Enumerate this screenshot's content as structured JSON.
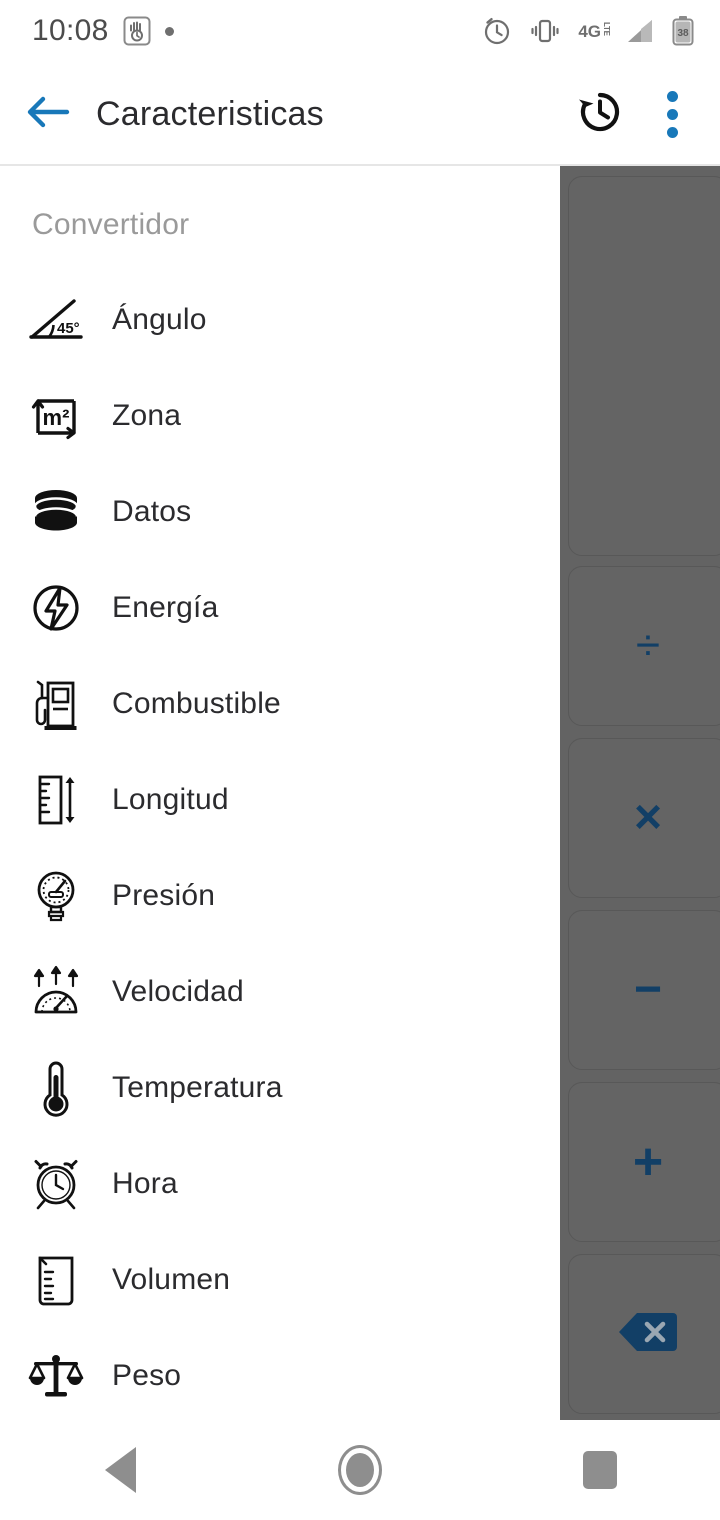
{
  "status_bar": {
    "time": "10:08",
    "icons_left": [
      "digital-wellbeing-icon",
      "notification-dot-icon"
    ],
    "network_label": "4G",
    "network_suffix": "LTE",
    "battery_level": "38",
    "icons_right": [
      "alarm-icon",
      "vibrate-icon",
      "network-4glte-icon",
      "signal-icon",
      "battery-icon"
    ]
  },
  "app_bar": {
    "back_icon": "arrow-left-icon",
    "title": "Caracteristicas",
    "history_icon": "history-icon",
    "overflow_icon": "more-vertical-icon",
    "accent_color": "#1878b9"
  },
  "drawer": {
    "section_title": "Convertidor",
    "items": [
      {
        "label": "Ángulo",
        "icon": "angle-45-icon"
      },
      {
        "label": "Zona",
        "icon": "square-meter-icon"
      },
      {
        "label": "Datos",
        "icon": "database-icon"
      },
      {
        "label": "Energía",
        "icon": "energy-bolt-icon"
      },
      {
        "label": "Combustible",
        "icon": "fuel-pump-icon"
      },
      {
        "label": "Longitud",
        "icon": "ruler-icon"
      },
      {
        "label": "Presión",
        "icon": "pressure-gauge-icon"
      },
      {
        "label": "Velocidad",
        "icon": "speedometer-icon"
      },
      {
        "label": "Temperatura",
        "icon": "thermometer-icon"
      },
      {
        "label": "Hora",
        "icon": "alarm-clock-icon"
      },
      {
        "label": "Volumen",
        "icon": "beaker-icon"
      },
      {
        "label": "Peso",
        "icon": "balance-scale-icon"
      }
    ]
  },
  "calculator": {
    "display_value": "",
    "scrim_color": "#636363",
    "operator_color": "#123f66",
    "keys": [
      {
        "label": "÷",
        "name": "divide-key"
      },
      {
        "label": "×",
        "name": "multiply-key"
      },
      {
        "label": "−",
        "name": "minus-key"
      },
      {
        "label": "+",
        "name": "plus-key"
      },
      {
        "label": "",
        "name": "backspace-key"
      }
    ]
  },
  "nav_bar": {
    "back": "nav-back-icon",
    "home": "nav-home-icon",
    "recents": "nav-recents-icon"
  }
}
